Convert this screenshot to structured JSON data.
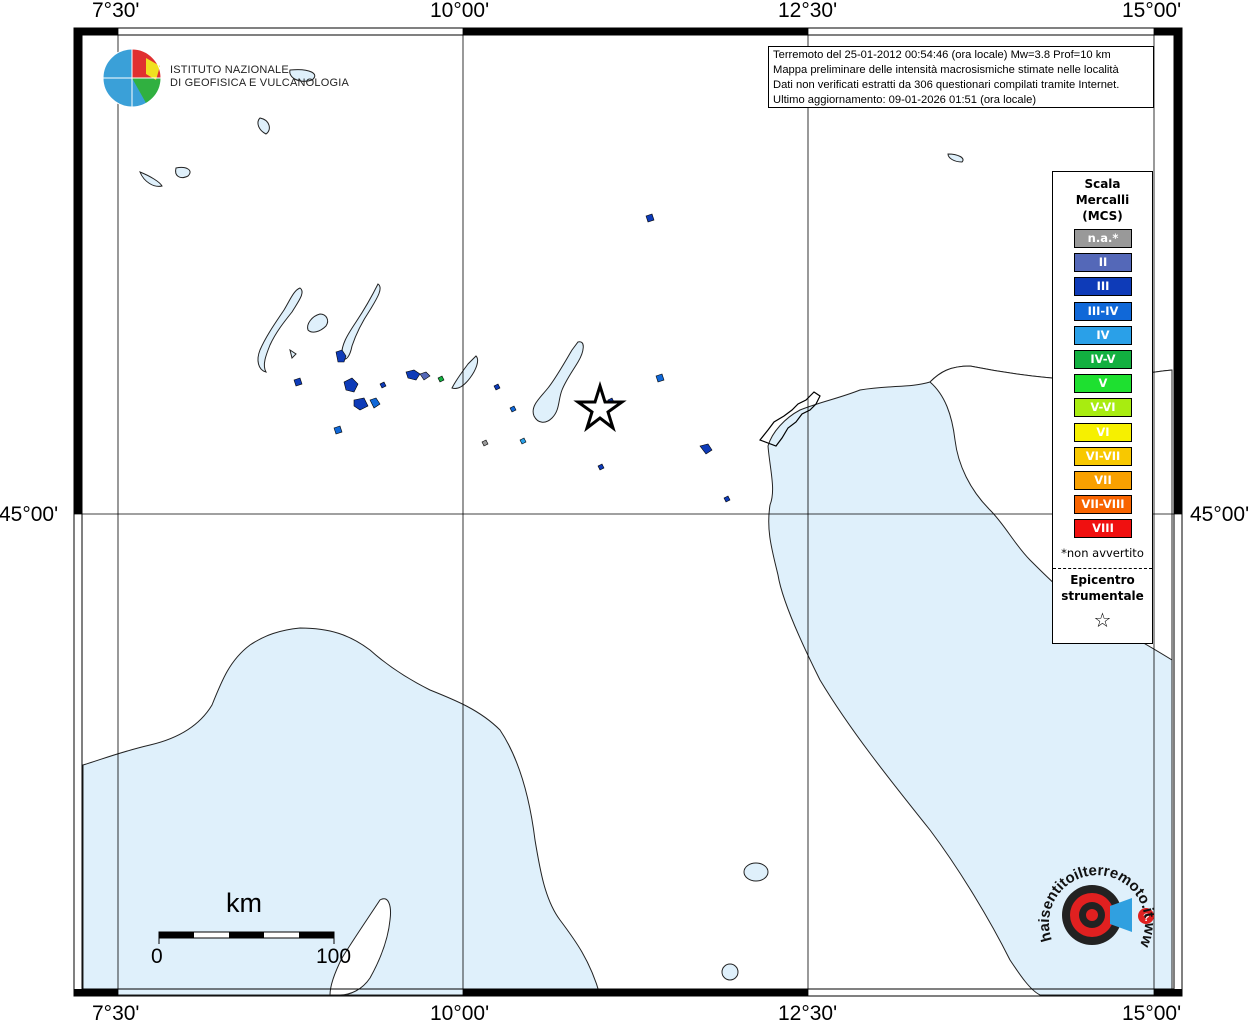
{
  "map": {
    "frame_labels": {
      "top": [
        "7°30'",
        "10°00'",
        "12°30'",
        "15°00'"
      ],
      "bottom": [
        "7°30'",
        "10°00'",
        "12°30'",
        "15°00'"
      ],
      "left": "45°00'",
      "right": "45°00'"
    },
    "epicenter_marker": "star-icon"
  },
  "logo": {
    "line1": "ISTITUTO NAZIONALE",
    "line2": "DI GEOFISICA E VULCANOLOGIA"
  },
  "info": {
    "line1": "Terremoto del 25-01-2012 00:54:46 (ora locale) Mw=3.8 Prof=10 km",
    "line2": "Mappa preliminare delle intensità macrosismiche stimate nelle località",
    "line3": "Dati non verificati estratti da 306 questionari compilati tramite Internet.",
    "line4": "Ultimo aggiornamento: 09-01-2026 01:51 (ora locale)"
  },
  "legend": {
    "title_line1": "Scala",
    "title_line2": "Mercalli",
    "title_line3": "(MCS)",
    "items": [
      {
        "label": "n.a.*",
        "color": "#999999"
      },
      {
        "label": "II",
        "color": "#5468b8"
      },
      {
        "label": "III",
        "color": "#0e3bb8"
      },
      {
        "label": "III-IV",
        "color": "#1068d8"
      },
      {
        "label": "IV",
        "color": "#2aa0e8"
      },
      {
        "label": "IV-V",
        "color": "#12b040"
      },
      {
        "label": "V",
        "color": "#1ee030"
      },
      {
        "label": "V-VI",
        "color": "#a8ec10"
      },
      {
        "label": "VI",
        "color": "#f6f000"
      },
      {
        "label": "VI-VII",
        "color": "#f8c800"
      },
      {
        "label": "VII",
        "color": "#f8a000"
      },
      {
        "label": "VII-VIII",
        "color": "#f86400"
      },
      {
        "label": "VIII",
        "color": "#f01010"
      }
    ],
    "note": "*non avvertito",
    "epicenter_line1": "Epicentro",
    "epicenter_line2": "strumentale",
    "epicenter_icon": "star-icon"
  },
  "scalebar": {
    "unit": "km",
    "min": "0",
    "max": "100"
  },
  "badge": {
    "text": "haisentitoilterremoto.it  www.",
    "icon": "target-icon"
  },
  "colors": {
    "sea": "#dff0fb",
    "coast": "#000000"
  }
}
